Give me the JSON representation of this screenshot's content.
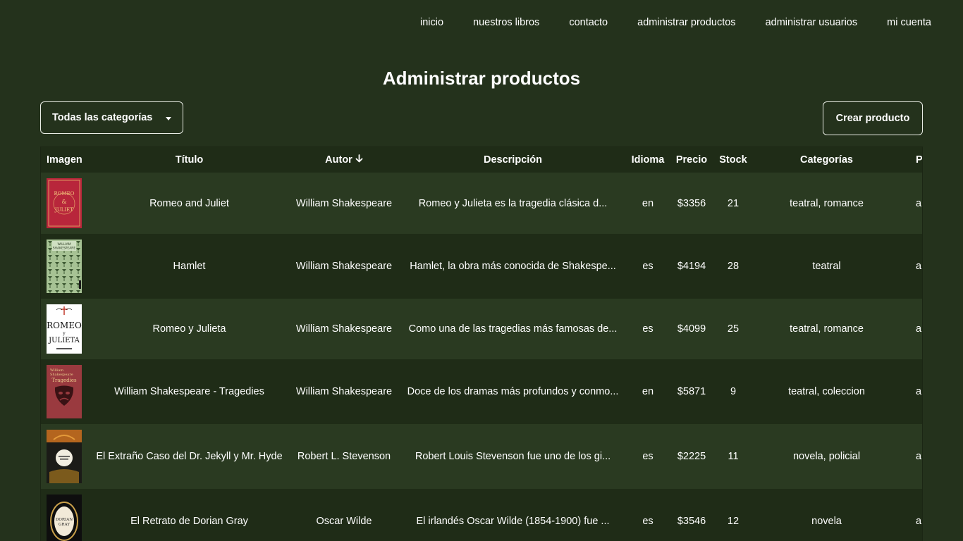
{
  "nav": {
    "items": [
      "inicio",
      "nuestros libros",
      "contacto",
      "administrar productos",
      "administrar usuarios",
      "mi cuenta"
    ]
  },
  "page": {
    "title": "Administrar productos"
  },
  "filters": {
    "category_selected": "Todas las categorías"
  },
  "actions": {
    "create_label": "Crear producto"
  },
  "table": {
    "headers": {
      "image": "Imagen",
      "title": "Título",
      "author": "Autor",
      "author_sort_icon": "arrow-down-icon",
      "description": "Descripción",
      "language": "Idioma",
      "price": "Precio",
      "stock": "Stock",
      "categories": "Categorías",
      "extra": "Pro"
    },
    "rows": [
      {
        "title": "Romeo and Juliet",
        "author": "William Shakespeare",
        "description": "Romeo y Julieta es la tragedia clásica d...",
        "language": "en",
        "price": "$3356",
        "stock": "21",
        "categories": "teatral, romance",
        "extra": "a",
        "cover_text": [
          "ROMEO",
          "&",
          "JULIET"
        ]
      },
      {
        "title": "Hamlet",
        "author": "William Shakespeare",
        "description": "Hamlet, la obra más conocida de Shakespe...",
        "language": "es",
        "price": "$4194",
        "stock": "28",
        "categories": "teatral",
        "extra": "a",
        "cover_text": [
          "WILLIAM",
          "SHAKESPEARE"
        ]
      },
      {
        "title": "Romeo y Julieta",
        "author": "William Shakespeare",
        "description": "Como una de las tragedias más famosas de...",
        "language": "es",
        "price": "$4099",
        "stock": "25",
        "categories": "teatral, romance",
        "extra": "a",
        "cover_text": [
          "ROMEO",
          "y",
          "JULIETA"
        ]
      },
      {
        "title": "William Shakespeare - Tragedies",
        "author": "William Shakespeare",
        "description": "Doce de los dramas más profundos y conmo...",
        "language": "en",
        "price": "$5871",
        "stock": "9",
        "categories": "teatral, coleccion",
        "extra": "a",
        "cover_text": [
          "William",
          "Shakespeare",
          "Tragedies"
        ]
      },
      {
        "title": "El Extraño Caso del Dr. Jekyll y Mr. Hyde",
        "author": "Robert L. Stevenson",
        "description": "Robert Louis Stevenson fue uno de los gi...",
        "language": "es",
        "price": "$2225",
        "stock": "11",
        "categories": "novela, policial",
        "extra": "a",
        "cover_text": []
      },
      {
        "title": "El Retrato de Dorian Gray",
        "author": "Oscar Wilde",
        "description": "El irlandés Oscar Wilde (1854-1900) fue ...",
        "language": "es",
        "price": "$3546",
        "stock": "12",
        "categories": "novela",
        "extra": "a",
        "cover_text": [
          "DORIAN",
          "GRAY"
        ]
      }
    ]
  },
  "colors": {
    "background": "#24321c",
    "row_light": "#2a3a21",
    "row_dark": "#1f2c17",
    "text": "#ffffff",
    "border": "#e8ece4"
  }
}
